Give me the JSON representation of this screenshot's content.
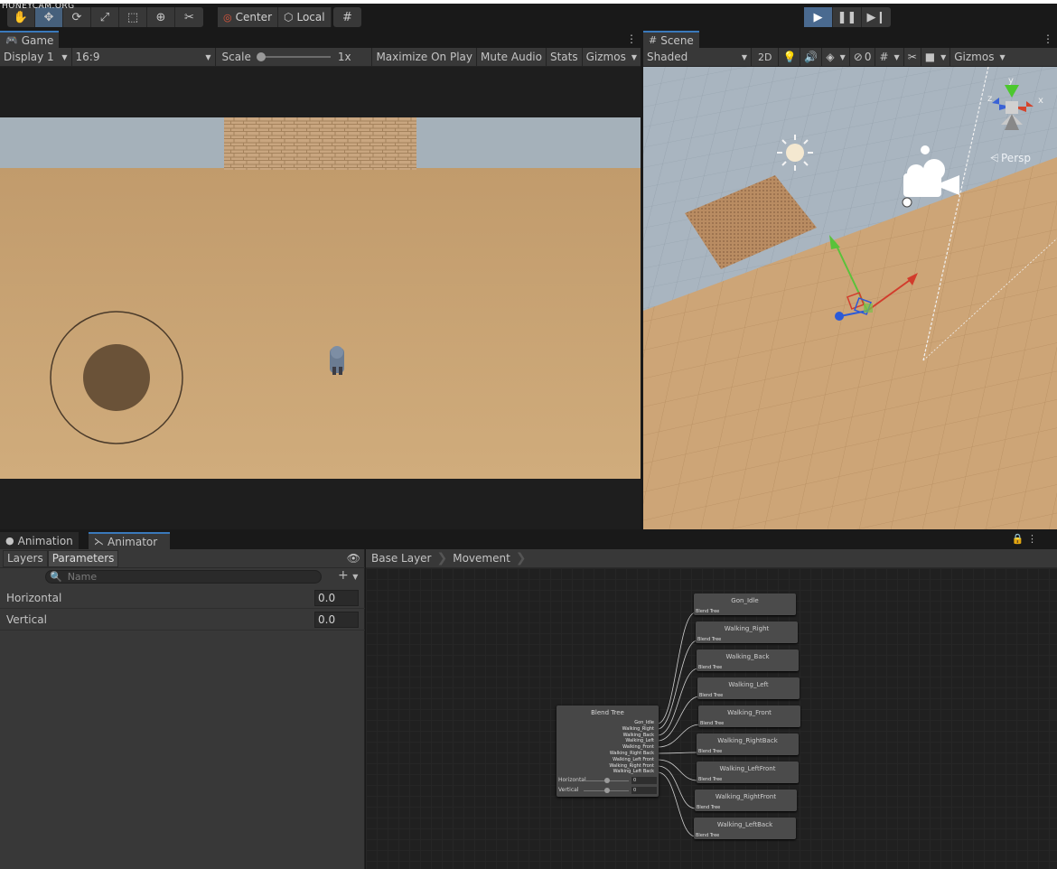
{
  "watermark": "HONEYCAM.ORG",
  "toolbar": {
    "tools": [
      "hand-icon",
      "move-icon",
      "rotate-icon",
      "scale-icon",
      "rect-icon",
      "transform-icon",
      "custom-tool-icon"
    ],
    "pivot_label": "Center",
    "space_label": "Local",
    "snap_icon": "grid-snap-icon",
    "play_icon": "play-icon",
    "pause_icon": "pause-icon",
    "step_icon": "step-icon"
  },
  "game": {
    "tab_label": "Game",
    "display": "Display 1",
    "aspect": "16:9",
    "scale_label": "Scale",
    "scale_value": "1x",
    "maximize": "Maximize On Play",
    "mute": "Mute Audio",
    "stats": "Stats",
    "gizmos": "Gizmos"
  },
  "scene": {
    "tab_label": "Scene",
    "shading": "Shaded",
    "mode_2d": "2D",
    "hidden_count": "0",
    "gizmos": "Gizmos",
    "persp_label": "Persp",
    "axis_labels": {
      "x": "x",
      "y": "y",
      "z": "z"
    }
  },
  "bottom": {
    "tabs": [
      "Animation",
      "Animator"
    ],
    "param_tabs": [
      "Layers",
      "Parameters"
    ],
    "search_placeholder": "Name",
    "parameters": [
      {
        "name": "Horizontal",
        "value": "0.0"
      },
      {
        "name": "Vertical",
        "value": "0.0"
      }
    ],
    "breadcrumb": [
      "Base Layer",
      "Movement"
    ]
  },
  "blend_tree": {
    "title": "Blend Tree",
    "motions": [
      "Gon_Idle",
      "Walking_Right",
      "Walking_Back",
      "Walking_Left",
      "Walking_Front",
      "Walking_Right Back",
      "Walking_Left Front",
      "Walking_Right Front",
      "Walking_Left Back"
    ],
    "params": [
      {
        "name": "Horizontal",
        "value": "0"
      },
      {
        "name": "Vertical",
        "value": "0"
      }
    ]
  },
  "nodes": [
    {
      "title": "Gon_Idle",
      "sub": "Blend Tree"
    },
    {
      "title": "Walking_Right",
      "sub": "Blend Tree"
    },
    {
      "title": "Walking_Back",
      "sub": "Blend Tree"
    },
    {
      "title": "Walking_Left",
      "sub": "Blend Tree"
    },
    {
      "title": "Walking_Front",
      "sub": "Blend Tree"
    },
    {
      "title": "Walking_RightBack",
      "sub": "Blend Tree"
    },
    {
      "title": "Walking_LeftFront",
      "sub": "Blend Tree"
    },
    {
      "title": "Walking_RightFront",
      "sub": "Blend Tree"
    },
    {
      "title": "Walking_LeftBack",
      "sub": "Blend Tree"
    }
  ],
  "colors": {
    "accent": "#3a79bb",
    "panel": "#383838",
    "ground": "#c79f6d",
    "sky": "#9eaebd"
  }
}
